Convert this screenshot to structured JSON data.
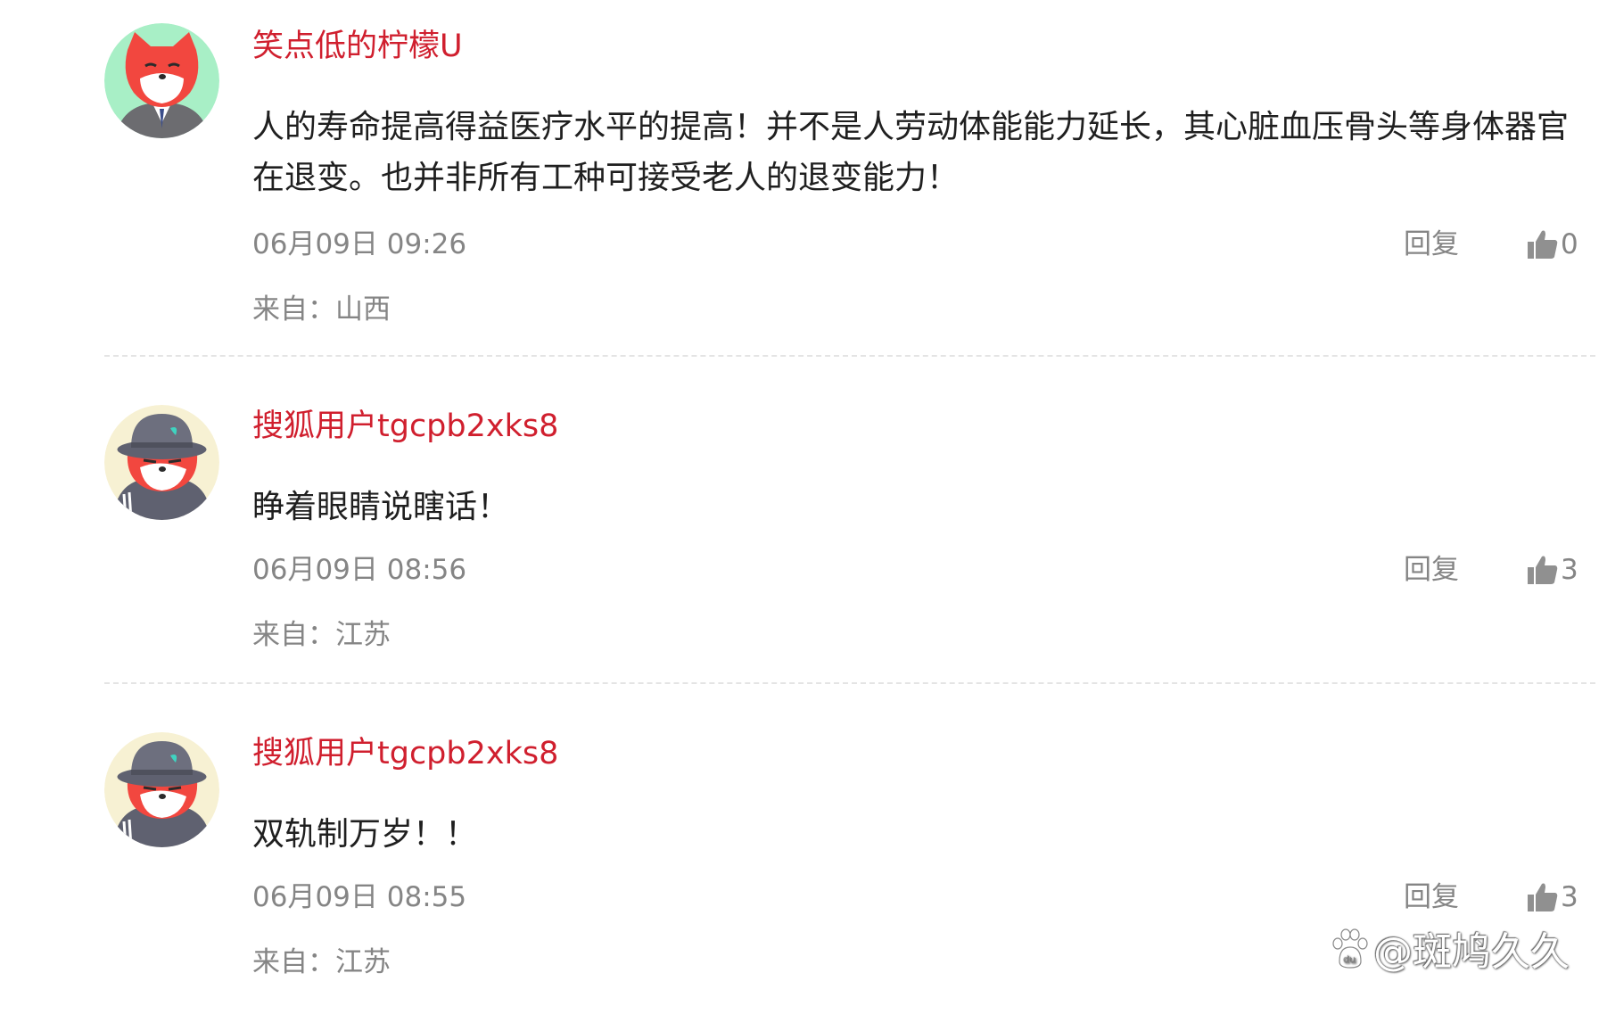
{
  "comments": [
    {
      "username": "笑点低的柠檬U",
      "avatar": "fox-suit-avatar",
      "content": "人的寿命提高得益医疗水平的提高！并不是人劳动体能能力延长，其心脏血压骨头等身体器官在退变。也并非所有工种可接受老人的退变能力！",
      "time": "06月09日 09:26",
      "location": "来自：山西",
      "reply_label": "回复",
      "likes": "0"
    },
    {
      "username": "搜狐用户tgcpb2xks8",
      "avatar": "fox-hat-avatar",
      "content": "睁着眼睛说瞎话！",
      "time": "06月09日 08:56",
      "location": "来自：江苏",
      "reply_label": "回复",
      "likes": "3"
    },
    {
      "username": "搜狐用户tgcpb2xks8",
      "avatar": "fox-hat-avatar",
      "content": "双轨制万岁！！",
      "time": "06月09日 08:55",
      "location": "来自：江苏",
      "reply_label": "回复",
      "likes": "3"
    }
  ],
  "icons": {
    "like": "thumbs-up-icon",
    "watermark": "paw-icon"
  },
  "colors": {
    "username": "#d01f2e",
    "meta": "#858585",
    "text": "#1f1f1f",
    "divider": "#e4e4e4"
  },
  "watermark": {
    "text": "@斑鸠久久",
    "logo_text": "du"
  }
}
